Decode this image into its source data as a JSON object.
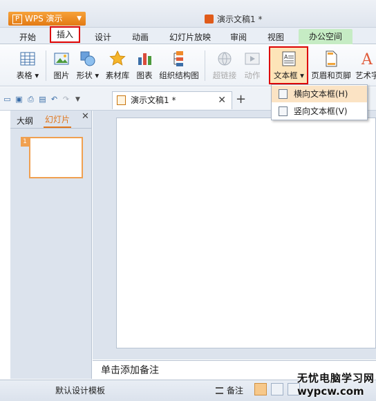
{
  "titlebar": {
    "app_button": "WPS 演示",
    "document_title": "演示文稿1 *"
  },
  "menu": {
    "tabs": [
      "开始",
      "插入",
      "设计",
      "动画",
      "幻灯片放映",
      "审阅",
      "视图",
      "办公空间"
    ]
  },
  "ribbon": {
    "table": "表格",
    "picture": "图片",
    "shape": "形状",
    "clipart": "素材库",
    "chart": "图表",
    "smartart": "组织结构图",
    "hyperlink": "超链接",
    "action": "动作",
    "textbox": "文本框",
    "header_footer": "页眉和页脚",
    "wordart": "艺术字"
  },
  "doc_tab": {
    "label": "演示文稿1 *"
  },
  "left_panel": {
    "outline_tab": "大纲",
    "slides_tab": "幻灯片",
    "thumb_number": "1"
  },
  "dropdown": {
    "horizontal": "横向文本框(H)",
    "vertical": "竖向文本框(V)"
  },
  "notes": {
    "placeholder": "单击添加备注"
  },
  "statusbar": {
    "template": "默认设计模板",
    "notes": "备注"
  },
  "watermark": {
    "line1": "无忧电脑学习网",
    "line2": "wypcw.com"
  },
  "colors": {
    "accent_orange": "#e37a14",
    "highlight_red": "#dd0000",
    "office_green": "#c6ecc4"
  }
}
